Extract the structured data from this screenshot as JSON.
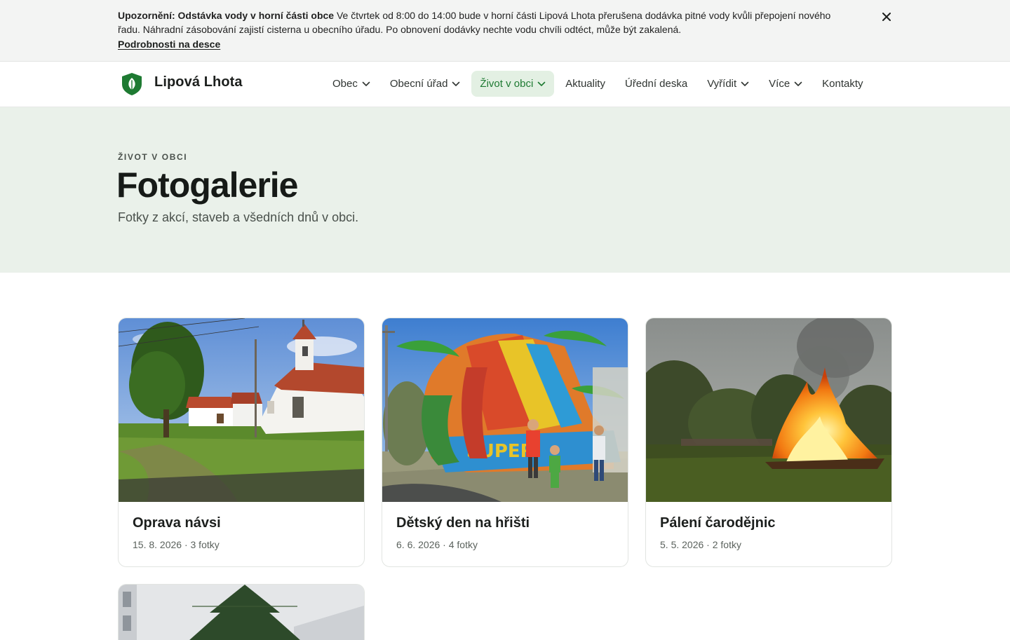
{
  "alert": {
    "title": "Upozornění: Odstávka vody v horní části obce",
    "body": " Ve čtvrtek od 8:00 do 14:00 bude v horní části Lipová Lhota přerušena dodávka pitné vody kvůli přepojení nového řadu. Náhradní zásobování zajistí cisterna u obecního úřadu. Po obnovení dodávky nechte vodu chvíli odtéct, může být zakalená.",
    "link": "Podrobnosti na desce",
    "close_icon": "close-icon"
  },
  "header": {
    "site_name": "Lipová Lhota",
    "logo_icon": "shield-leaf-icon",
    "nav": [
      {
        "label": "Obec",
        "has_dropdown": true,
        "active": false
      },
      {
        "label": "Obecní úřad",
        "has_dropdown": true,
        "active": false
      },
      {
        "label": "Život v obci",
        "has_dropdown": true,
        "active": true
      },
      {
        "label": "Aktuality",
        "has_dropdown": false,
        "active": false
      },
      {
        "label": "Úřední deska",
        "has_dropdown": false,
        "active": false
      },
      {
        "label": "Vyřídit",
        "has_dropdown": true,
        "active": false
      },
      {
        "label": "Více",
        "has_dropdown": true,
        "active": false
      },
      {
        "label": "Kontakty",
        "has_dropdown": false,
        "active": false
      }
    ]
  },
  "hero": {
    "eyebrow": "ŽIVOT V OBCI",
    "title": "Fotogalerie",
    "lead": "Fotky z akcí, staveb a všedních dnů v obci."
  },
  "gallery": [
    {
      "title": "Oprava návsi",
      "meta": "15. 8. 2026 · 3 fotky",
      "image": "village-square-chapel-photo"
    },
    {
      "title": "Dětský den na hřišti",
      "meta": "6. 6. 2026 · 4 fotky",
      "image": "inflatable-slide-photo"
    },
    {
      "title": "Pálení čarodějnic",
      "meta": "5. 5. 2026 · 2 fotky",
      "image": "bonfire-photo"
    },
    {
      "title": "",
      "meta": "",
      "image": "christmas-tree-photo"
    }
  ],
  "colors": {
    "brand_green": "#1e7a32",
    "hero_bg": "#eaf1ea",
    "alert_bg": "#f3f4f3"
  }
}
